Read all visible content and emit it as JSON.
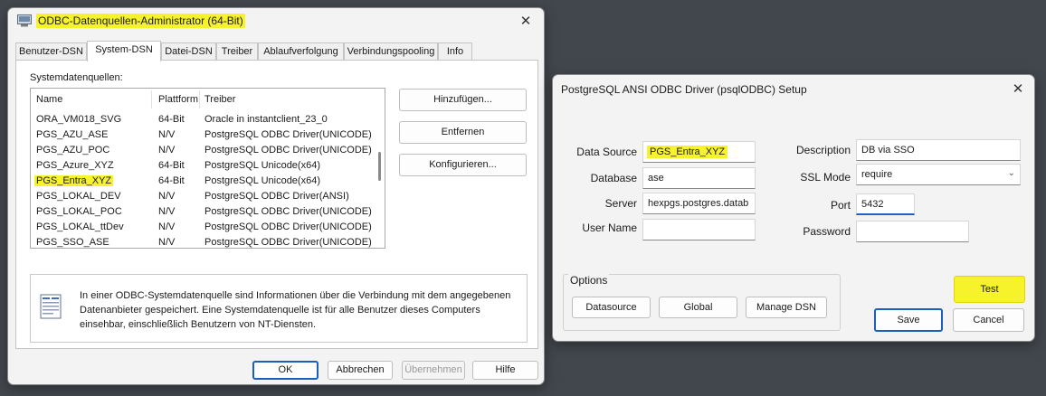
{
  "odbc_window": {
    "title": "ODBC-Datenquellen-Administrator (64-Bit)",
    "tabs": [
      "Benutzer-DSN",
      "System-DSN",
      "Datei-DSN",
      "Treiber",
      "Ablaufverfolgung",
      "Verbindungspooling",
      "Info"
    ],
    "active_tab": "System-DSN",
    "list_label": "Systemdatenquellen:",
    "columns": [
      "Name",
      "Plattform",
      "Treiber"
    ],
    "rows": [
      {
        "name": "ORA_VM018_SVG",
        "platform": "64-Bit",
        "driver": "Oracle in instantclient_23_0"
      },
      {
        "name": "PGS_AZU_ASE",
        "platform": "N/V",
        "driver": "PostgreSQL ODBC Driver(UNICODE)"
      },
      {
        "name": "PGS_AZU_POC",
        "platform": "N/V",
        "driver": "PostgreSQL ODBC Driver(UNICODE)"
      },
      {
        "name": "PGS_Azure_XYZ",
        "platform": "64-Bit",
        "driver": "PostgreSQL Unicode(x64)"
      },
      {
        "name": "PGS_Entra_XYZ",
        "platform": "64-Bit",
        "driver": "PostgreSQL Unicode(x64)"
      },
      {
        "name": "PGS_LOKAL_DEV",
        "platform": "N/V",
        "driver": "PostgreSQL ODBC Driver(ANSI)"
      },
      {
        "name": "PGS_LOKAL_POC",
        "platform": "N/V",
        "driver": "PostgreSQL ODBC Driver(UNICODE)"
      },
      {
        "name": "PGS_LOKAL_ttDev",
        "platform": "N/V",
        "driver": "PostgreSQL ODBC Driver(UNICODE)"
      },
      {
        "name": "PGS_SSO_ASE",
        "platform": "N/V",
        "driver": "PostgreSQL ODBC Driver(UNICODE)"
      }
    ],
    "highlighted_row": "PGS_Entra_XYZ",
    "buttons": {
      "add": "Hinzufügen...",
      "remove": "Entfernen",
      "configure": "Konfigurieren..."
    },
    "info_text": "In einer ODBC-Systemdatenquelle sind Informationen über die Verbindung mit dem angegebenen Datenanbieter gespeichert. Eine Systemdatenquelle ist für alle Benutzer dieses Computers einsehbar, einschließlich Benutzern von NT-Diensten.",
    "footer": {
      "ok": "OK",
      "cancel": "Abbrechen",
      "apply": "Übernehmen",
      "help": "Hilfe"
    },
    "close_glyph": "✕"
  },
  "pg_window": {
    "title": "PostgreSQL ANSI ODBC Driver (psqlODBC) Setup",
    "close_glyph": "✕",
    "labels": {
      "data_source": "Data Source",
      "database": "Database",
      "server": "Server",
      "user_name": "User Name",
      "description": "Description",
      "ssl_mode": "SSL Mode",
      "port": "Port",
      "password": "Password"
    },
    "values": {
      "data_source": "PGS_Entra_XYZ",
      "database": "ase",
      "server": "hexpgs.postgres.datab",
      "user_name": "",
      "description": "DB via SSO",
      "ssl_mode": "require",
      "port": "5432",
      "password": ""
    },
    "options_label": "Options",
    "buttons": {
      "datasource": "Datasource",
      "global": "Global",
      "manage_dsn": "Manage DSN",
      "test": "Test",
      "save": "Save",
      "cancel": "Cancel"
    }
  },
  "colors": {
    "highlight": "#f6f32a",
    "focus": "#1b63c8",
    "desktop": "#42474d"
  },
  "icons": {
    "app": "odbc-app-icon",
    "info": "document-info-icon",
    "close": "close-icon",
    "dropdown": "chevron-down-icon"
  }
}
